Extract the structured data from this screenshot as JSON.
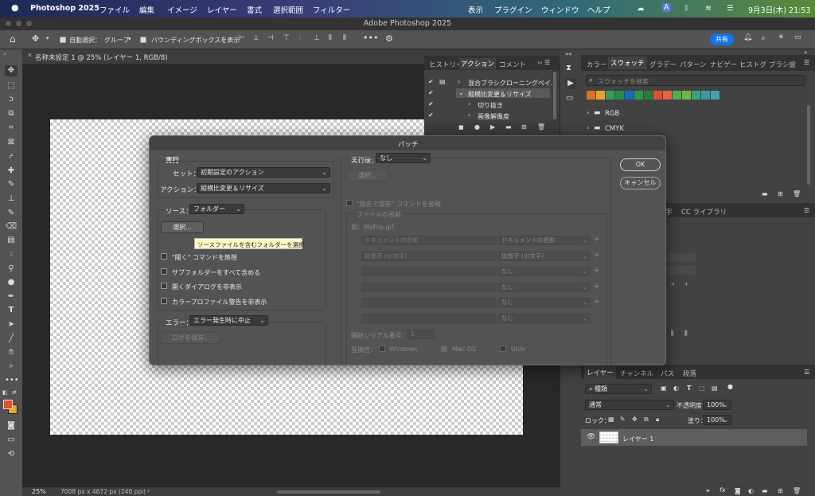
{
  "menubar": {
    "app": "Photoshop 2025",
    "file": "ファイル",
    "edit": "編集",
    "image": "イメージ",
    "layer": "レイヤー",
    "type": "書式",
    "select": "選択範囲",
    "filter": "フィルター",
    "view": "表示",
    "plugins": "プラグイン",
    "window": "ウィンドウ",
    "help": "ヘルプ",
    "input": "A",
    "date": "9月3日(木) 21:53"
  },
  "window": {
    "title": "Adobe Photoshop 2025"
  },
  "options": {
    "auto_select_label": "自動選択：",
    "auto_select_value": "グループ",
    "bbox_label": "バウンディングボックスを表示",
    "share": "共有"
  },
  "doc": {
    "tab": "名称未設定 1 @ 25% (レイヤー 1, RGB/8)",
    "zoom": "25%",
    "size": "7008 px x 4672 px (240 ppi)"
  },
  "actions_panel": {
    "tabs": [
      "ヒストリー",
      "アクション",
      "コメント"
    ],
    "items": [
      "混合ブラシクローニングペイ...",
      "縦横比変更＆リサイズ",
      "切り抜き",
      "画像解像度"
    ]
  },
  "swatch_panel": {
    "tabs": [
      "カラー",
      "スウォッチ",
      "グラデー",
      "パターン",
      "ナビゲー",
      "ヒストグ",
      "ブラシ設"
    ],
    "search_placeholder": "スウォッチを検索",
    "groups": [
      "RGB",
      "CMYK"
    ],
    "colors": [
      "#e07020",
      "#e8a030",
      "#3a9a5a",
      "#2a8a4a",
      "#1a6ac0",
      "#2a9a4a",
      "#2a7a3a",
      "#e05030",
      "#ea6040",
      "#50b050",
      "#70b840",
      "#3aa080",
      "#3a9aa0",
      "#4aa0b0"
    ]
  },
  "mid_panel": {
    "tab_partial": "字",
    "cc_library": "CC ライブラリ"
  },
  "layers_panel": {
    "tabs": [
      "レイヤー",
      "チャンネル",
      "パス",
      "段落"
    ],
    "kind": "種類",
    "blend": "通常",
    "opacity_label": "不透明度：",
    "opacity": "100%",
    "lock_label": "ロック：",
    "fill_label": "塗り：",
    "fill": "100%",
    "layer_name": "レイヤー 1"
  },
  "dialog": {
    "title": "バッチ",
    "play_group": "実行",
    "set_label": "セット：",
    "set_value": "初期設定のアクション",
    "action_label": "アクション：",
    "action_value": "縦横比変更＆リサイズ",
    "source_label": "ソース：",
    "source_value": "フォルダー",
    "choose": "選択...",
    "tooltip": "ソースファイルを含むフォルダーを選択",
    "cb1": "\"開く\" コマンドを無視",
    "cb2": "サブフォルダーをすべて含める",
    "cb3": "開くダイアログを非表示",
    "cb4": "カラープロファイル警告を非表示",
    "error_label": "エラー：",
    "error_value": "エラー発生時に中止",
    "save_log": "ログを保存...",
    "dest_label": "実行後：",
    "dest_value": "なし",
    "dest_choose": "選択...",
    "override_save": "\"別名で保存\" コマンドを省略",
    "file_naming": "ファイルの名前",
    "example": "例：MyFile.gif",
    "name_fields": [
      "ドキュメントの名前",
      "拡張子 (小文字)",
      "",
      "",
      "",
      ""
    ],
    "name_selects": [
      "ドキュメントの名前",
      "拡張子 (小文字)",
      "なし",
      "なし",
      "なし",
      "なし"
    ],
    "serial_label": "開始シリアル番号：",
    "serial_value": "1",
    "compat_label": "互換性：",
    "windows": "Windows",
    "macos": "Mac OS",
    "unix": "Unix",
    "ok": "OK",
    "cancel": "キャンセル"
  }
}
